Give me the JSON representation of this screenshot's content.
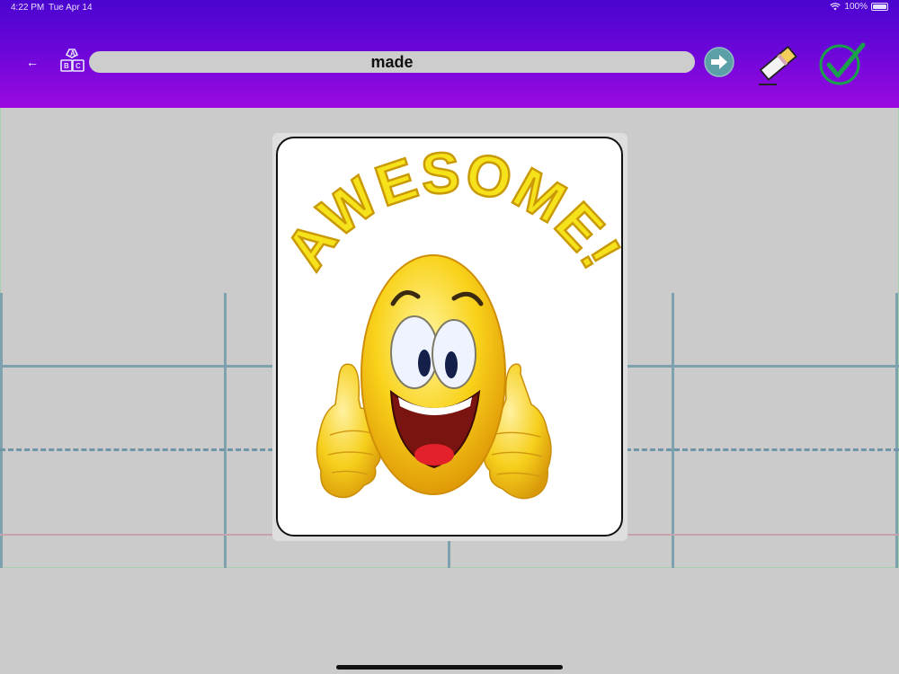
{
  "status_bar": {
    "time": "4:22 PM",
    "date": "Tue Apr 14",
    "battery": "100%"
  },
  "toolbar": {
    "back_icon": "←",
    "abc_icon": "abc-blocks-icon",
    "word": "made",
    "next_icon": "arrow-right-circle-icon",
    "eraser_icon": "eraser-icon",
    "check_icon": "checkmark-icon"
  },
  "popup": {
    "text": "AWESOME!"
  },
  "colors": {
    "header_top": "#4a04d0",
    "header_bottom": "#9a0ae0",
    "guide_line": "#7ea1ae",
    "baseline_pink": "#c6a3ad",
    "next_button": "#5aa0a6",
    "check_green": "#1aa04a"
  }
}
